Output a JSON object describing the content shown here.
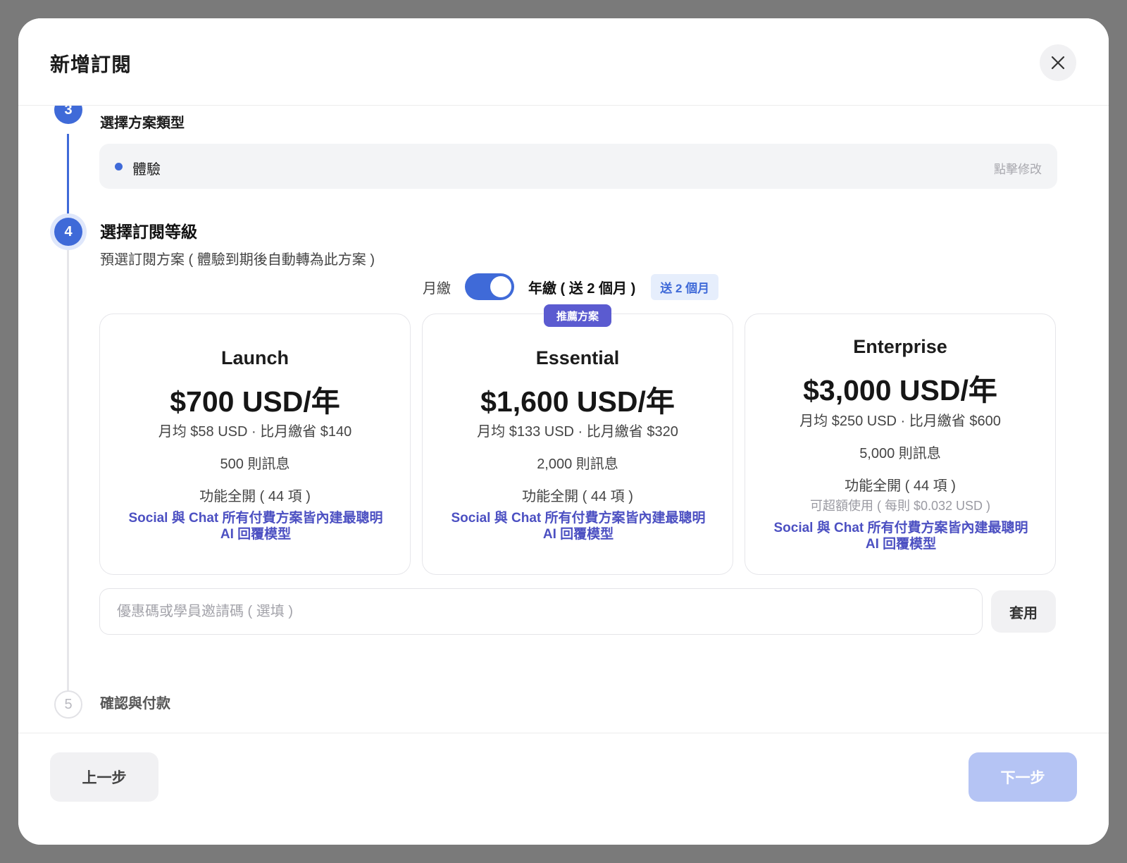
{
  "modal": {
    "title": "新增訂閱",
    "close_icon": "close-icon"
  },
  "steps": {
    "step3": {
      "number": "3",
      "title": "選擇方案類型",
      "selected_label": "體驗",
      "edit_label": "點擊修改"
    },
    "step4": {
      "number": "4",
      "title": "選擇訂閱等級",
      "subtitle": "預選訂閱方案 ( 體驗到期後自動轉為此方案 )"
    },
    "step5": {
      "number": "5",
      "title": "確認與付款"
    }
  },
  "billing": {
    "monthly_label": "月繳",
    "yearly_label": "年繳 ( 送 2 個月 )",
    "badge": "送 2 個月",
    "yearly_selected": true
  },
  "plans": [
    {
      "name": "Launch",
      "price": "$700 USD/年",
      "avg": "月均 $58 USD · 比月繳省 $140",
      "messages": "500 則訊息",
      "features": "功能全開 ( 44 項 )",
      "ai_note": "Social 與 Chat 所有付費方案皆內建最聰明 AI 回覆模型"
    },
    {
      "name": "Essential",
      "badge": "推薦方案",
      "price": "$1,600 USD/年",
      "avg": "月均 $133 USD · 比月繳省 $320",
      "messages": "2,000 則訊息",
      "features": "功能全開 ( 44 項 )",
      "ai_note": "Social 與 Chat 所有付費方案皆內建最聰明 AI 回覆模型"
    },
    {
      "name": "Enterprise",
      "price": "$3,000 USD/年",
      "avg": "月均 $250 USD · 比月繳省 $600",
      "messages": "5,000 則訊息",
      "features": "功能全開 ( 44 項 )",
      "overage": "可超額使用 ( 每則 $0.032 USD )",
      "ai_note": "Social 與 Chat 所有付費方案皆內建最聰明 AI 回覆模型"
    }
  ],
  "coupon": {
    "placeholder": "優惠碼或學員邀請碼 ( 選填 )",
    "value": "",
    "apply_label": "套用"
  },
  "footer": {
    "prev_label": "上一步",
    "next_label": "下一步"
  },
  "colors": {
    "accent": "#3f6ad8",
    "ai_text": "#4c50c2",
    "recommended_badge": "#5b5bd0",
    "next_disabled": "#b5c4f4"
  }
}
